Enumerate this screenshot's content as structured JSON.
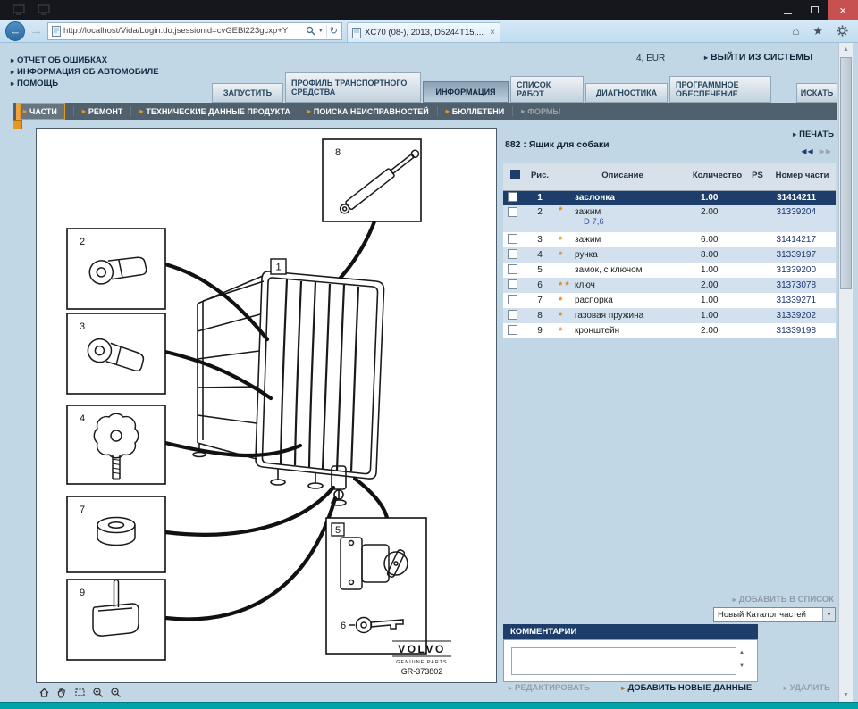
{
  "browser": {
    "url": "http://localhost/Vida/Login.do;jsessionid=cvGEBl223gcxp+Y",
    "tab_title": "XC70 (08-), 2013, D5244T15,..."
  },
  "icons": {
    "link_arrow": "▸",
    "dropdown_arrow": "▼",
    "pager_prev": "◀◀",
    "pager_next": "▶▶",
    "back_arrow": "←",
    "forward_arrow": "→",
    "refresh": "↻",
    "home": "⌂",
    "favorites": "★",
    "close": "×",
    "scroll_up": "▲",
    "scroll_down": "▼"
  },
  "header": {
    "currency": "4, EUR",
    "logout_label": "ВЫЙТИ ИЗ СИСТЕМЫ",
    "links": [
      {
        "label": "ОТЧЕТ ОБ ОШИБКАХ"
      },
      {
        "label": "ИНФОРМАЦИЯ ОБ АВТОМОБИЛЕ"
      },
      {
        "label": "ПОМОЩЬ"
      }
    ]
  },
  "main_tabs": [
    {
      "label": "ЗАПУСТИТЬ"
    },
    {
      "label": "ПРОФИЛЬ ТРАНСПОРТНОГО СРЕДСТВА"
    },
    {
      "label": "ИНФОРМАЦИЯ"
    },
    {
      "label": "СПИСОК РАБОТ"
    },
    {
      "label": "ДИАГНОСТИКА"
    },
    {
      "label": "ПРОГРАММНОЕ ОБЕСПЕЧЕНИЕ"
    },
    {
      "label": "ИСКАТЬ"
    }
  ],
  "subnav": [
    {
      "label": "ЧАСТИ"
    },
    {
      "label": "РЕМОНТ"
    },
    {
      "label": "ТЕХНИЧЕСКИЕ ДАННЫЕ ПРОДУКТА"
    },
    {
      "label": "ПОИСКА НЕИСПРАВНОСТЕЙ"
    },
    {
      "label": "БЮЛЛЕТЕНИ"
    },
    {
      "label": "ФОРМЫ"
    }
  ],
  "diagram": {
    "callouts": [
      "1",
      "2",
      "3",
      "4",
      "5",
      "6",
      "7",
      "8",
      "9"
    ],
    "brand": "VOLVO",
    "brand_sub": "GENUINE PARTS",
    "drawing_no": "GR-373802"
  },
  "parts": {
    "title": "882 : Ящик для собаки",
    "print_label": "ПЕЧАТЬ",
    "columns": {
      "fig": "Рис.",
      "desc": "Описание",
      "qty": "Количество",
      "ps": "PS",
      "num": "Номер части"
    },
    "rows": [
      {
        "fig": "1",
        "stars": "",
        "desc": "заслонка",
        "qty": "1.00",
        "num": "31414211"
      },
      {
        "fig": "2",
        "stars": "*",
        "desc": "зажим",
        "desc2": "D 7,6",
        "qty": "2.00",
        "num": "31339204"
      },
      {
        "fig": "3",
        "stars": "*",
        "desc": "зажим",
        "qty": "6.00",
        "num": "31414217"
      },
      {
        "fig": "4",
        "stars": "*",
        "desc": "ручка",
        "qty": "8.00",
        "num": "31339197"
      },
      {
        "fig": "5",
        "stars": "",
        "desc": "замок, с ключом",
        "qty": "1.00",
        "num": "31339200"
      },
      {
        "fig": "6",
        "stars": "* *",
        "desc": "ключ",
        "qty": "2.00",
        "num": "31373078"
      },
      {
        "fig": "7",
        "stars": "*",
        "desc": "распорка",
        "qty": "1.00",
        "num": "31339271"
      },
      {
        "fig": "8",
        "stars": "*",
        "desc": "газовая пружина",
        "qty": "1.00",
        "num": "31339202"
      },
      {
        "fig": "9",
        "stars": "*",
        "desc": "кронштейн",
        "qty": "2.00",
        "num": "31339198"
      }
    ],
    "add_to_list_label": "ДОБАВИТЬ В СПИСОК",
    "catalog_select_value": "Новый Каталог частей"
  },
  "comments": {
    "title": "КОММЕНТАРИИ",
    "edit_label": "РЕДАКТИРОВАТЬ",
    "add_label": "ДОБАВИТЬ НОВЫЕ ДАННЫЕ",
    "delete_label": "УДАЛИТЬ"
  },
  "colors": {
    "accent_orange": "#e8820c",
    "selected_row": "#1d3d6b",
    "statusbar_teal": "#00a3a8"
  }
}
